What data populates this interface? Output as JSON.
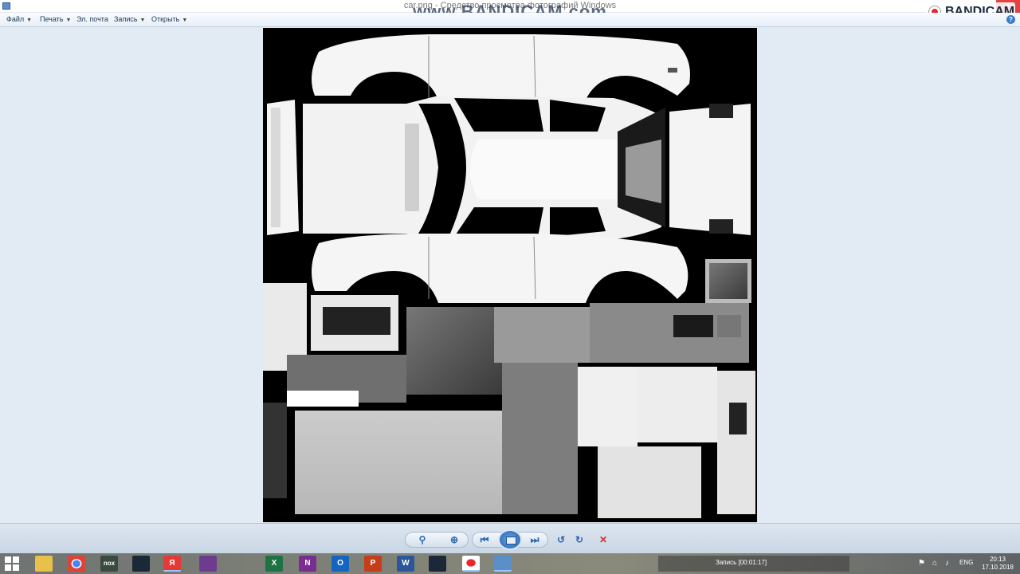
{
  "window": {
    "title": "car.png - Средство просмотра фотографий Windows",
    "watermark": "www.BANDICAM.com",
    "close_glyph": "✕"
  },
  "recorder": {
    "brand": "BANDICAM",
    "status": "Запись [00:01:17]"
  },
  "menu": {
    "items": [
      {
        "label": "Файл",
        "has_dropdown": true
      },
      {
        "label": "Печать",
        "has_dropdown": true
      },
      {
        "label": "Эл. почта",
        "has_dropdown": false
      },
      {
        "label": "Запись",
        "has_dropdown": true
      },
      {
        "label": "Открыть",
        "has_dropdown": true
      }
    ],
    "help_glyph": "?"
  },
  "viewer": {
    "image_description": "car texture UV map"
  },
  "controls": {
    "zoom_glyph": "⚲",
    "fit_glyph": "⊕",
    "prev_glyph": "⏮",
    "next_glyph": "⏭",
    "rotate_ccw_glyph": "↺",
    "rotate_cw_glyph": "↻",
    "delete_glyph": "✕"
  },
  "taskbar": {
    "language": "ENG",
    "time": "20:13",
    "date": "17.10.2018",
    "apps": [
      "file-explorer",
      "chrome",
      "nox",
      "steam",
      "yandex",
      "winrar",
      "excel",
      "onenote",
      "outlook",
      "powerpoint",
      "word",
      "steam-2",
      "bandicam",
      "photo-viewer"
    ],
    "app_glyphs": {
      "nox": "nox",
      "yandex": "Я",
      "excel": "X",
      "onenote": "N",
      "outlook": "O",
      "powerpoint": "P",
      "word": "W"
    }
  },
  "colors": {
    "accent": "#2a67b1",
    "record_red": "#e8262b",
    "close_red": "#e04343"
  }
}
